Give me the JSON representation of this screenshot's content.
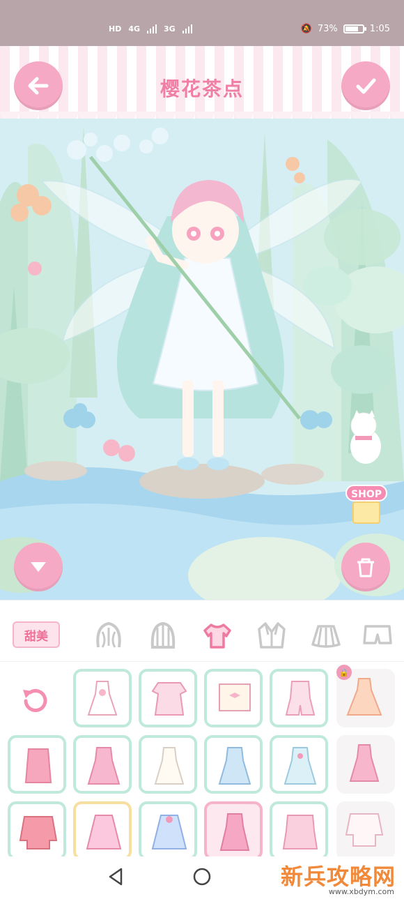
{
  "statusbar": {
    "net1": "HD",
    "net2": "4G",
    "net3": "3G",
    "battery": "73%",
    "time": "1:05"
  },
  "header": {
    "title": "樱花茶点"
  },
  "scene": {
    "shop_label": "SHOP"
  },
  "panel": {
    "style_chip": "甜美",
    "categories": [
      "hair",
      "hairstyle-back",
      "top",
      "jacket",
      "skirt",
      "pants"
    ],
    "selected_category": "top"
  },
  "watermark": {
    "text": "新兵攻略网",
    "url": "www.xbdym.com"
  },
  "colors": {
    "accent": "#f07fa6",
    "button": "#f6a9c5",
    "frame_mint": "#bfe9dc",
    "frame_gold": "#f7dfa2"
  }
}
